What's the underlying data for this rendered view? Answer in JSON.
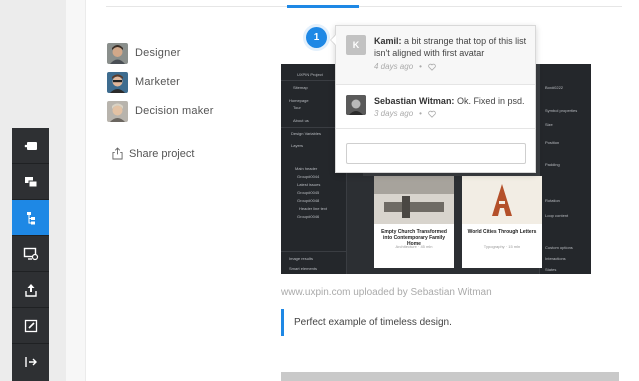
{
  "team": [
    {
      "role": "Designer",
      "avatar_icon": "user-avatar"
    },
    {
      "role": "Marketer",
      "avatar_icon": "user-avatar"
    },
    {
      "role": "Decision maker",
      "avatar_icon": "user-avatar"
    }
  ],
  "share": {
    "label": "Share project",
    "icon": "share-icon"
  },
  "toolbar": {
    "items": [
      {
        "name": "comment-mode",
        "icon": "comment-toggle-icon",
        "active": false
      },
      {
        "name": "layers",
        "icon": "layers-icon",
        "active": false
      },
      {
        "name": "flow",
        "icon": "flow-icon",
        "active": true
      },
      {
        "name": "preview",
        "icon": "screen-preview-icon",
        "active": false
      },
      {
        "name": "export",
        "icon": "upload-icon",
        "active": false
      },
      {
        "name": "edit",
        "icon": "edit-icon",
        "active": false
      },
      {
        "name": "exit",
        "icon": "exit-icon",
        "active": false
      }
    ]
  },
  "marker": {
    "number": "1"
  },
  "comments": [
    {
      "initial": "K",
      "author": "Kamil:",
      "text": " a bit strange that top of this list isn't aligned with first avatar",
      "time": "4 days ago",
      "sep": "•"
    },
    {
      "initial": "",
      "author": "Sebastian Witman:",
      "text": " Ok. Fixed in psd.",
      "time": "3 days ago",
      "sep": "•"
    }
  ],
  "reply": {
    "placeholder": ""
  },
  "screenshot": {
    "left_panel": [
      "Sitemap",
      "Homepage",
      "Tour",
      "About us",
      "Design Variables",
      "Layers",
      "Main header",
      "Group#0044",
      "Latest issues",
      "Group#0045",
      "Group#0048",
      "Header line text",
      "Group#0046",
      "Image results",
      "Smart elements"
    ],
    "right_panel": [
      "Box#0222",
      "Symbol properties",
      "Size",
      "Position",
      "Padding",
      "Rotation",
      "Loop content",
      "Custom options",
      "Interactions",
      "States"
    ],
    "top_label": "UXPIN Project",
    "cards": [
      {
        "title": "Empty Church Transformed into Contemporary Family Home",
        "meta": "Architecture · 45 mln"
      },
      {
        "title": "World Cities Through Letters",
        "meta": "Typography · 15 mln"
      }
    ]
  },
  "caption": "www.uxpin.com uploaded by Sebastian Witman",
  "description": "Perfect example of timeless design.",
  "colors": {
    "accent": "#1e88e5",
    "toolbar": "#2e3033",
    "rail": "#ececec"
  }
}
